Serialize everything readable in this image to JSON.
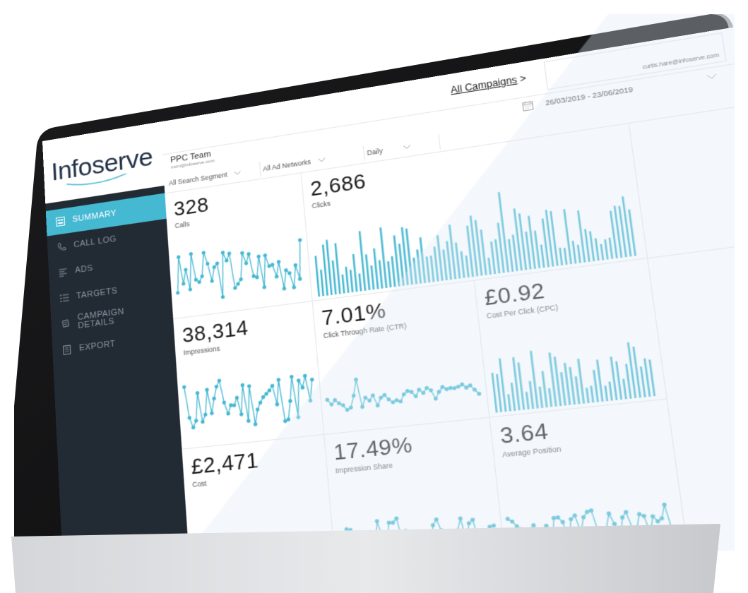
{
  "brand": {
    "name": "Infoserve"
  },
  "nav": {
    "items": [
      {
        "label": "SUMMARY",
        "icon": "summary-icon",
        "active": true
      },
      {
        "label": "CALL LOG",
        "icon": "phone-icon",
        "active": false
      },
      {
        "label": "ADS",
        "icon": "ads-icon",
        "active": false
      },
      {
        "label": "TARGETS",
        "icon": "targets-icon",
        "active": false
      },
      {
        "label": "CAMPAIGN\nDETAILS",
        "icon": "campaign-details-icon",
        "active": false
      },
      {
        "label": "EXPORT",
        "icon": "export-icon",
        "active": false
      }
    ]
  },
  "header": {
    "breadcrumb_link": "All Campaigns",
    "breadcrumb_sep": ">",
    "user_email": "curtis.hare@infoserve.com",
    "settings_icon": "gear-icon"
  },
  "team": {
    "name": "PPC Team",
    "email": "mcm@infoserve.com"
  },
  "filters": {
    "search_segment": "All Search Segment",
    "ad_networks": "All Ad Networks",
    "frequency": "Daily",
    "date_range": "26/03/2019 - 23/06/2019",
    "calendar_icon": "calendar-icon"
  },
  "colors": {
    "accent": "#45b8d2",
    "sidebar": "#222a33",
    "text": "#1b1b1b"
  },
  "tiles": {
    "calls": {
      "value": "328",
      "label": "Calls"
    },
    "clicks": {
      "value": "2,686",
      "label": "Clicks"
    },
    "impressions": {
      "value": "38,314",
      "label": "Impressions"
    },
    "ctr": {
      "value": "7.01%",
      "label": "Click Through Rate (CTR)"
    },
    "cpc": {
      "value": "£0.92",
      "label": "Cost Per Click (CPC)"
    },
    "cost": {
      "value": "£2,471",
      "label": "Cost"
    },
    "impression_share": {
      "value": "17.49%",
      "label": "Impression Share"
    },
    "avg_position": {
      "value": "3.64",
      "label": "Average Position"
    }
  }
}
